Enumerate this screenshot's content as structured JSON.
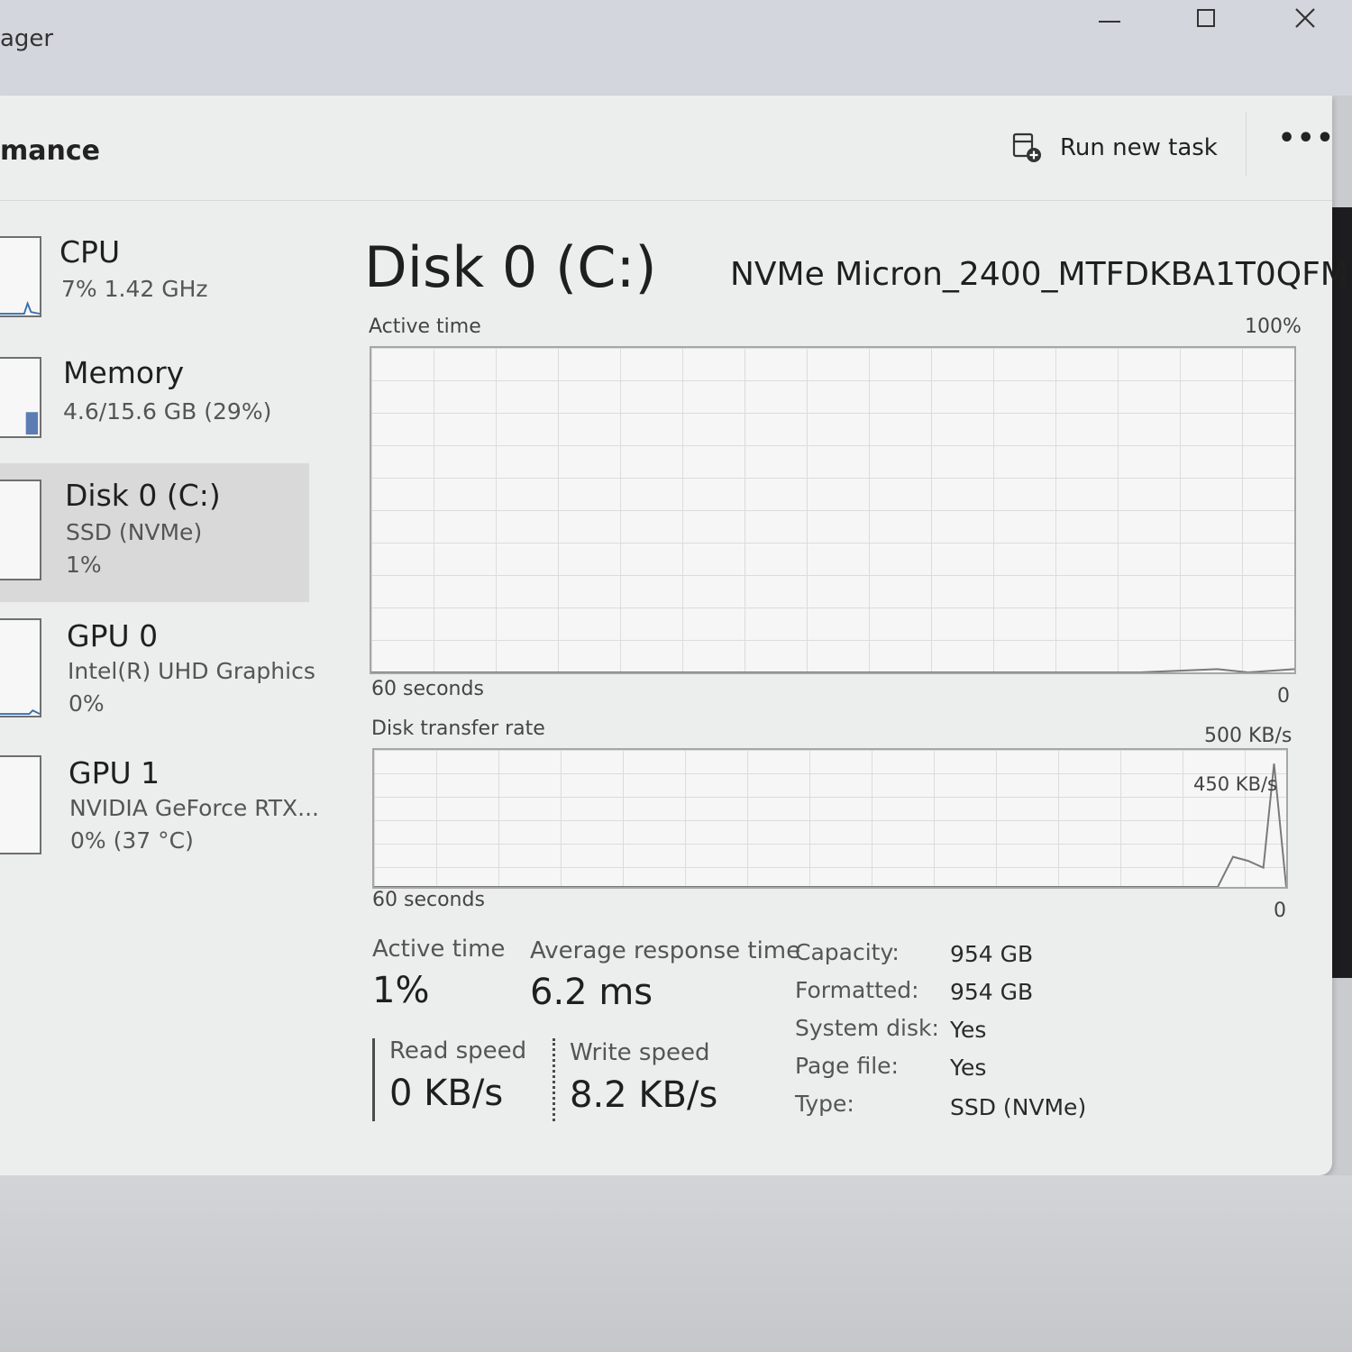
{
  "app": {
    "title_fragment": "ager"
  },
  "window_controls": {
    "minimize": "minimize-icon",
    "maximize": "maximize-icon",
    "close": "close-icon"
  },
  "header": {
    "page_title_fragment": "mance",
    "run_new_task": "Run new task",
    "more": "•••"
  },
  "sidebar": {
    "items": [
      {
        "title": "CPU",
        "sub1": "7%  1.42 GHz",
        "sub2": ""
      },
      {
        "title": "Memory",
        "sub1": "4.6/15.6 GB (29%)",
        "sub2": ""
      },
      {
        "title": "Disk 0 (C:)",
        "sub1": "SSD (NVMe)",
        "sub2": "1%"
      },
      {
        "title": "GPU 0",
        "sub1": "Intel(R) UHD Graphics",
        "sub2": "0%"
      },
      {
        "title": "GPU 1",
        "sub1": "NVIDIA GeForce RTX...",
        "sub2": "0%  (37 °C)"
      }
    ]
  },
  "main": {
    "title": "Disk 0 (C:)",
    "model": "NVMe Micron_2400_MTFDKBA1T0QFM",
    "active_graph": {
      "label": "Active time",
      "max": "100%",
      "time": "60 seconds",
      "min": "0"
    },
    "transfer_graph": {
      "label": "Disk transfer rate",
      "max": "500 KB/s",
      "annotation": "450 KB/s",
      "time": "60 seconds",
      "min": "0"
    },
    "stats": {
      "active_time_label": "Active time",
      "active_time_value": "1%",
      "avg_response_label": "Average response time",
      "avg_response_value": "6.2 ms",
      "read_label": "Read speed",
      "read_value": "0 KB/s",
      "write_label": "Write speed",
      "write_value": "8.2 KB/s"
    },
    "properties": [
      {
        "key": "Capacity:",
        "value": "954 GB"
      },
      {
        "key": "Formatted:",
        "value": "954 GB"
      },
      {
        "key": "System disk:",
        "value": "Yes"
      },
      {
        "key": "Page file:",
        "value": "Yes"
      },
      {
        "key": "Type:",
        "value": "SSD (NVMe)"
      }
    ]
  },
  "chart_data": [
    {
      "type": "line",
      "title": "Active time",
      "xlabel": "60 seconds",
      "ylim": [
        0,
        100
      ],
      "series": [
        {
          "x": [
            0,
            50,
            55,
            57,
            60
          ],
          "values": [
            0,
            0,
            1,
            0,
            1
          ]
        }
      ]
    },
    {
      "type": "line",
      "title": "Disk transfer rate",
      "xlabel": "60 seconds",
      "ylim": [
        0,
        500
      ],
      "series": [
        {
          "x": [
            0,
            55.5,
            56.5,
            57.5,
            58.5,
            59.2,
            60
          ],
          "values": [
            0,
            0,
            110,
            95,
            70,
            450,
            0
          ]
        }
      ]
    }
  ],
  "colors": {
    "window_bg": "#eceded",
    "sidebar_selected": "#d9d9da",
    "graph_line": "#7a7a7a",
    "thumb_fill": "#5b7db3"
  }
}
